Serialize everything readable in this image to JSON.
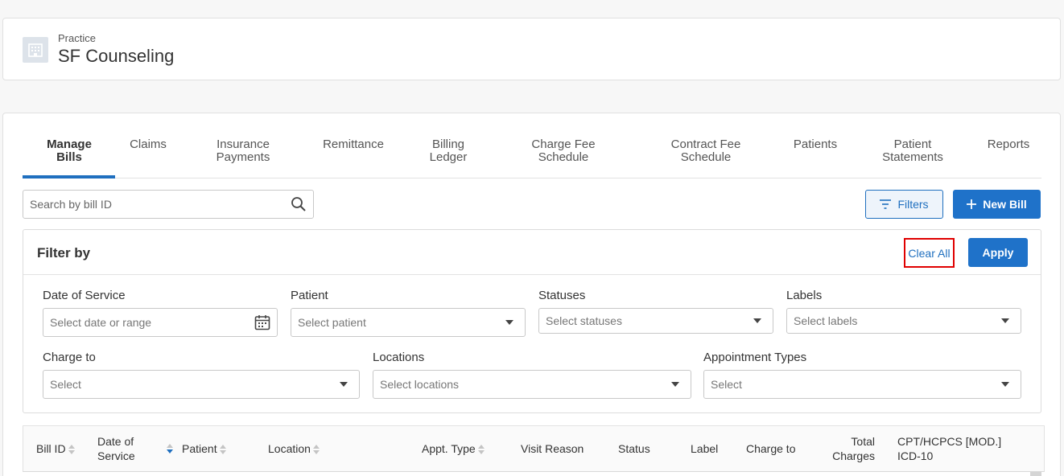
{
  "practice": {
    "label": "Practice",
    "name": "SF Counseling",
    "icon": "building-icon"
  },
  "tabs": [
    {
      "label": "Manage\nBills",
      "active": true
    },
    {
      "label": "Claims"
    },
    {
      "label": "Insurance\nPayments"
    },
    {
      "label": "Remittance"
    },
    {
      "label": "Billing\nLedger"
    },
    {
      "label": "Charge Fee\nSchedule"
    },
    {
      "label": "Contract Fee\nSchedule"
    },
    {
      "label": "Patients"
    },
    {
      "label": "Patient\nStatements"
    },
    {
      "label": "Reports"
    }
  ],
  "search": {
    "placeholder": "Search by bill ID",
    "value": ""
  },
  "toolbar": {
    "filters_label": "Filters",
    "new_bill_label": "New Bill"
  },
  "filter_panel": {
    "title": "Filter by",
    "clear_all_label": "Clear All",
    "apply_label": "Apply",
    "fields": {
      "date_of_service": {
        "label": "Date of Service",
        "placeholder": "Select date or range"
      },
      "patient": {
        "label": "Patient",
        "placeholder": "Select patient"
      },
      "statuses": {
        "label": "Statuses",
        "placeholder": "Select statuses"
      },
      "labels": {
        "label": "Labels",
        "placeholder": "Select labels"
      },
      "charge_to": {
        "label": "Charge to",
        "placeholder": "Select"
      },
      "locations": {
        "label": "Locations",
        "placeholder": "Select locations"
      },
      "appointment_types": {
        "label": "Appointment Types",
        "placeholder": "Select"
      }
    }
  },
  "table": {
    "columns": {
      "bill_id": "Bill ID",
      "date_of_service": "Date of\nService",
      "patient": "Patient",
      "location": "Location",
      "appt_type": "Appt. Type",
      "visit_reason": "Visit Reason",
      "status": "Status",
      "label": "Label",
      "charge_to": "Charge to",
      "total_charges": "Total\nCharges",
      "codes": "CPT/HCPCS [MOD.]\nICD-10"
    }
  },
  "colors": {
    "primary": "#1f72c9",
    "highlight": "#e00000"
  }
}
